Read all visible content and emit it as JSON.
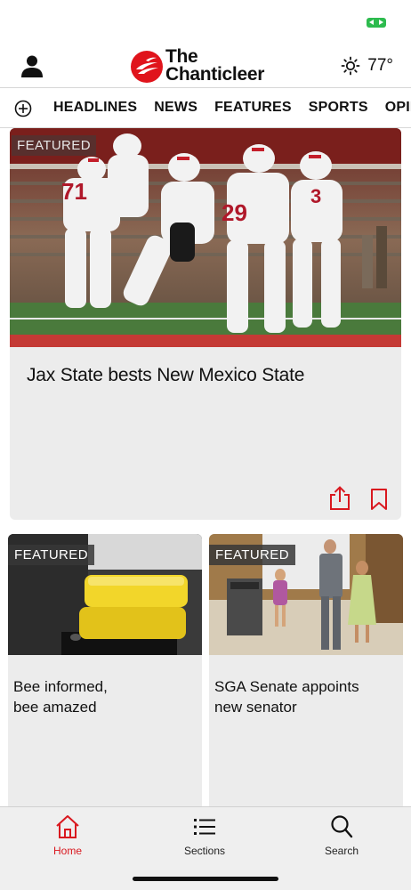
{
  "status_bar": {
    "battery_icon": "battery-charging-icon",
    "battery_color": "#2dbb4e"
  },
  "header": {
    "profile_icon": "person-icon",
    "logo": {
      "line1": "The",
      "line2": "Chanticleer",
      "color": "#e0141c"
    },
    "weather": {
      "icon": "sun-icon",
      "temperature": "77°"
    }
  },
  "nav": {
    "add_icon": "plus-circle-icon",
    "tabs": [
      {
        "label": "HEADLINES"
      },
      {
        "label": "NEWS"
      },
      {
        "label": "FEATURES"
      },
      {
        "label": "SPORTS"
      },
      {
        "label": "OPINION"
      }
    ]
  },
  "feed": {
    "hero": {
      "badge": "FEATURED",
      "title": "Jax State bests New Mexico State",
      "share_icon": "share-icon",
      "bookmark_icon": "bookmark-icon"
    },
    "cards": [
      {
        "badge": "FEATURED",
        "title_line1": "Bee informed,",
        "title_line2": "bee amazed"
      },
      {
        "badge": "FEATURED",
        "title_line1": "SGA Senate appoints",
        "title_line2": "new senator"
      }
    ]
  },
  "tabbar": {
    "accent": "#d9181f",
    "items": [
      {
        "label": "Home",
        "icon": "home-icon"
      },
      {
        "label": "Sections",
        "icon": "list-icon"
      },
      {
        "label": "Search",
        "icon": "search-icon"
      }
    ]
  }
}
